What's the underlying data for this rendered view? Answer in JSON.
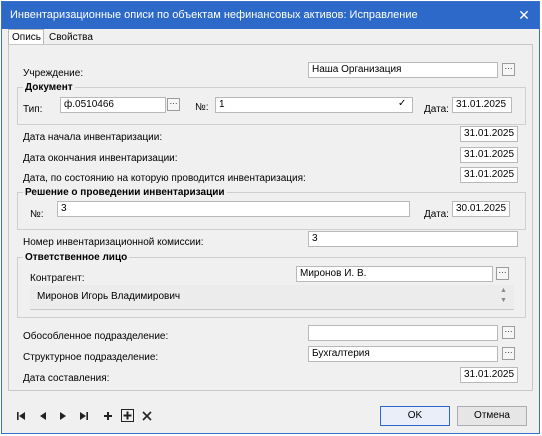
{
  "window": {
    "title": "Инвентаризационные описи по объектам нефинансовых активов: Исправление"
  },
  "tabs": [
    {
      "label": "Опись"
    },
    {
      "label": "Свойства"
    }
  ],
  "form": {
    "institution_label": "Учреждение:",
    "institution_value": "Наша Организация",
    "document_group": "Документ",
    "type_label": "Тип:",
    "type_value": "ф.0510466",
    "number_label": "№:",
    "number_value": "1",
    "date_label": "Дата:",
    "date_value": "31.01.2025",
    "inv_start_label": "Дата начала инвентаризации:",
    "inv_start_value": "31.01.2025",
    "inv_end_label": "Дата окончания инвентаризации:",
    "inv_end_value": "31.01.2025",
    "inv_state_label": "Дата, по состоянию на которую проводится инвентаризация:",
    "inv_state_value": "31.01.2025",
    "decision_group": "Решение о проведении инвентаризации",
    "decision_number_label": "№:",
    "decision_number_value": "3",
    "decision_date_label": "Дата:",
    "decision_date_value": "30.01.2025",
    "commission_label": "Номер инвентаризационной комиссии:",
    "commission_value": "3",
    "responsible_group": "Ответственное лицо",
    "counterparty_label": "Контрагент:",
    "counterparty_value": "Миронов И. В.",
    "counterparty_fullname": "Миронов Игорь Владимирович",
    "separate_division_label": "Обособленное подразделение:",
    "separate_division_value": "",
    "structural_division_label": "Структурное подразделение:",
    "structural_division_value": "Бухгалтерия",
    "compiled_date_label": "Дата составления:",
    "compiled_date_value": "31.01.2025"
  },
  "buttons": {
    "ok": "OK",
    "cancel": "Отмена"
  },
  "toolbar_icons": [
    "first-record-icon",
    "prev-record-icon",
    "next-record-icon",
    "last-record-icon",
    "add-icon",
    "add-boxed-icon",
    "delete-icon"
  ]
}
